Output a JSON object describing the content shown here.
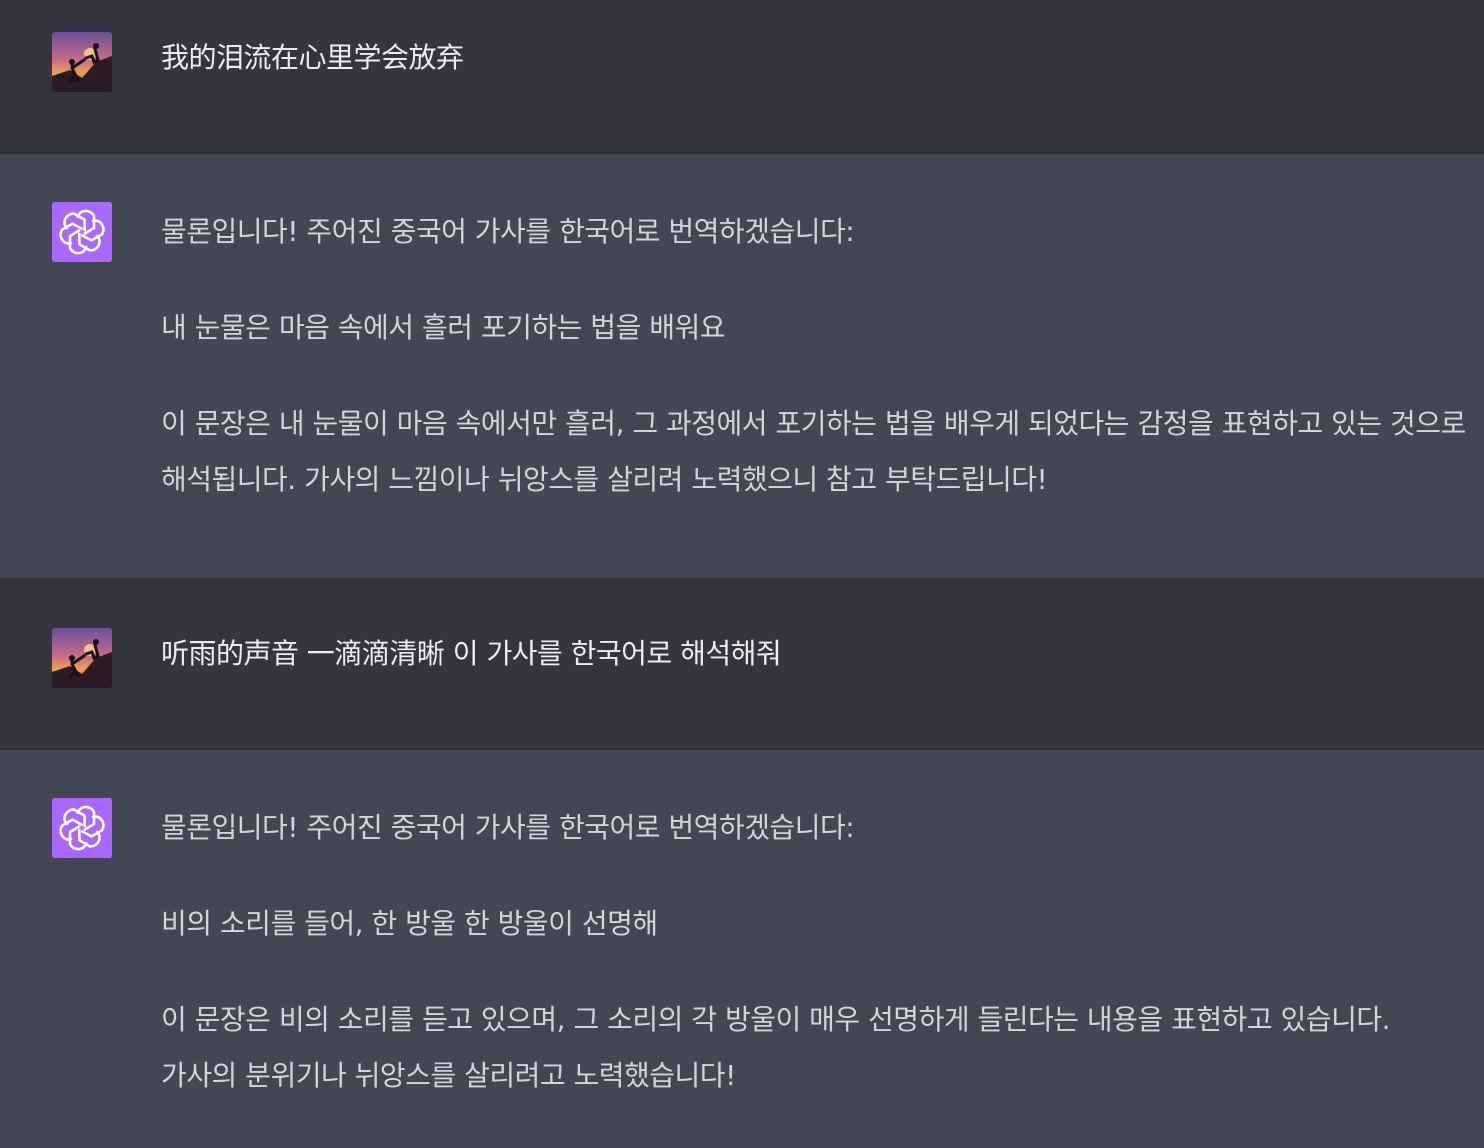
{
  "messages": [
    {
      "role": "user",
      "avatar_icon": "user-avatar-climbers-sunset",
      "text": "我的泪流在心里学会放弃"
    },
    {
      "role": "assistant",
      "avatar_icon": "chatgpt-logo-icon",
      "avatar_color": "#ab68ff",
      "paragraphs": [
        "물론입니다! 주어진 중국어 가사를 한국어로 번역하겠습니다:",
        "내 눈물은 마음 속에서 흘러 포기하는 법을 배워요",
        "이 문장은 내 눈물이 마음 속에서만 흘러, 그 과정에서 포기하는 법을 배우게 되었다는 감정을 표현하고 있는 것으로 해석됩니다. 가사의 느낌이나 뉘앙스를 살리려 노력했으니 참고 부탁드립니다!"
      ]
    },
    {
      "role": "user",
      "avatar_icon": "user-avatar-climbers-sunset",
      "text": "听雨的声音 一滴滴清晰 이 가사를 한국어로 해석해줘"
    },
    {
      "role": "assistant",
      "avatar_icon": "chatgpt-logo-icon",
      "avatar_color": "#ab68ff",
      "paragraphs": [
        "물론입니다! 주어진 중국어 가사를 한국어로 번역하겠습니다:",
        "비의 소리를 들어, 한 방울 한 방울이 선명해",
        "이 문장은 비의 소리를 듣고 있으며, 그 소리의 각 방울이 매우 선명하게 들린다는 내용을 표현하고 있습니다. 가사의 분위기나 뉘앙스를 살리려고 노력했습니다!"
      ]
    }
  ],
  "colors": {
    "user_bg": "#343541",
    "assistant_bg": "#444654",
    "assistant_avatar": "#ab68ff",
    "text": "#ececf1"
  }
}
